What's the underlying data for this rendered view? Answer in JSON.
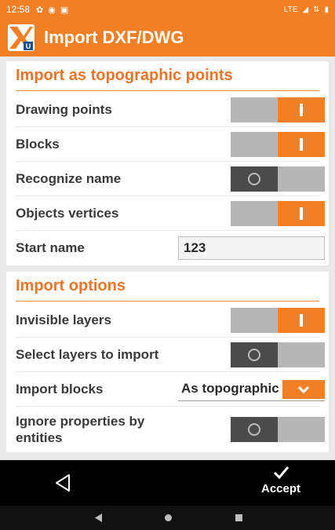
{
  "status_bar": {
    "time": "12:58",
    "right_text": "LTE"
  },
  "app": {
    "title": "Import DXF/DWG"
  },
  "section_topographic": {
    "header": "Import as topographic points",
    "drawing_points": {
      "label": "Drawing points",
      "on": true
    },
    "blocks": {
      "label": "Blocks",
      "on": true
    },
    "recognize_name": {
      "label": "Recognize name",
      "on": false
    },
    "objects_vertices": {
      "label": "Objects vertices",
      "on": true
    },
    "start_name": {
      "label": "Start name",
      "value": "123"
    }
  },
  "section_options": {
    "header": "Import options",
    "invisible_layers": {
      "label": "Invisible layers",
      "on": true
    },
    "select_layers": {
      "label": "Select layers to import",
      "on": false
    },
    "import_blocks": {
      "label": "Import blocks",
      "value": "As topographic"
    },
    "ignore_properties": {
      "label_line1": "Ignore properties by",
      "label_line2": "entities",
      "on": false
    }
  },
  "bottom_bar": {
    "accept_label": "Accept"
  },
  "icons": {
    "back": "back-triangle-icon",
    "accept": "check-icon",
    "dropdown": "chevron-down-icon"
  },
  "colors": {
    "accent": "#f07f25",
    "toggle_off": "#4b4b4b",
    "toggle_track": "#b6b6b6"
  }
}
